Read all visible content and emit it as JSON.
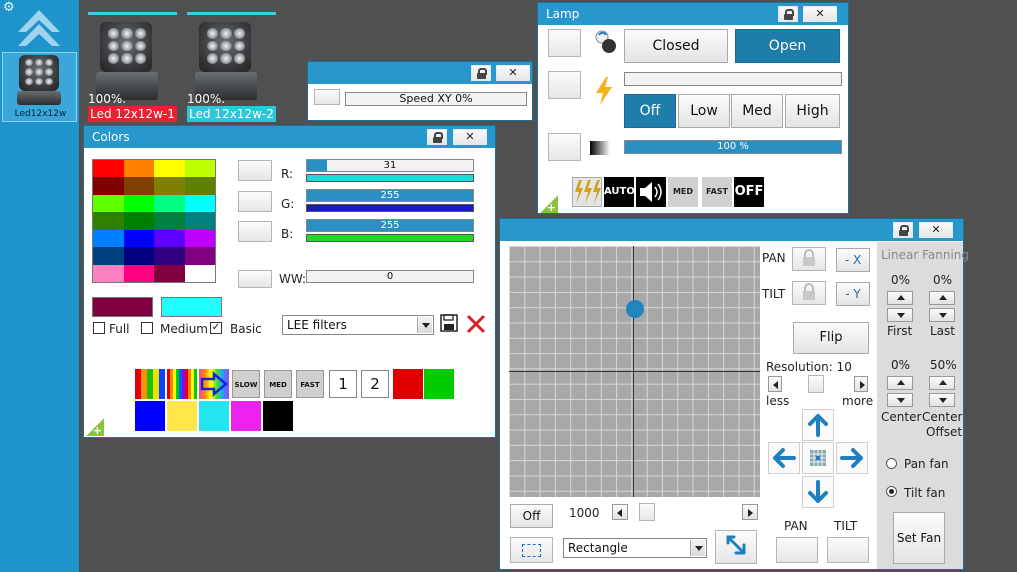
{
  "sidebar": {
    "selected_fixture_label": "Led12x12w"
  },
  "fixtures": [
    {
      "percent": "100%.",
      "label": "Led 12x12w-1",
      "label_bg": "#e52431",
      "label_color": "#ffffff"
    },
    {
      "percent": "100%.",
      "label": "Led 12x12w-2",
      "label_bg": "#2ec6d8",
      "label_color": "#ffffff"
    }
  ],
  "speed_window": {
    "bar_text": "Speed XY    0%"
  },
  "lamp": {
    "title": "Lamp",
    "closed_label": "Closed",
    "open_label": "Open",
    "speed_options": [
      "Off",
      "Low",
      "Med",
      "High"
    ],
    "selected_speed": "Off",
    "dimmer_text": "100 %",
    "dimmer_value": 100,
    "icons": {
      "auto": "AUTO",
      "med": "MED",
      "fast": "FAST",
      "off": "OFF"
    }
  },
  "colors": {
    "title": "Colors",
    "palette": [
      [
        "#ff0000",
        "#ff8000",
        "#ffff00",
        "#c0ff00"
      ],
      [
        "#800000",
        "#804000",
        "#808000",
        "#608000"
      ],
      [
        "#60ff00",
        "#00ff00",
        "#00ff80",
        "#00ffff"
      ],
      [
        "#308000",
        "#008000",
        "#008040",
        "#008080"
      ],
      [
        "#0080ff",
        "#0000ff",
        "#6000ff",
        "#c000ff"
      ],
      [
        "#004080",
        "#000080",
        "#300080",
        "#800080"
      ],
      [
        "#ff80c0",
        "#ff0080",
        "#800040",
        "#ffffff"
      ]
    ],
    "channels": [
      {
        "label": "R:",
        "value": "31",
        "fraction": 0.12,
        "track": "#22d8d8"
      },
      {
        "label": "G:",
        "value": "255",
        "fraction": 1.0,
        "track": "#1818c8"
      },
      {
        "label": "B:",
        "value": "255",
        "fraction": 1.0,
        "track": "#22d822"
      }
    ],
    "ww": {
      "label": "WW:",
      "value": "0",
      "fraction": 0
    },
    "current_color": "#800040",
    "target_color": "#1fffff",
    "checkboxes": [
      {
        "label": "Full",
        "checked": false
      },
      {
        "label": "Medium",
        "checked": false
      },
      {
        "label": "Basic",
        "checked": true
      }
    ],
    "filter_select": "LEE filters",
    "effect_tiles": {
      "slow": "SLOW",
      "med": "MED",
      "fast": "FAST"
    },
    "number_tiles": [
      "1",
      "2"
    ],
    "quick_colors": [
      "#e00000",
      "#00cc00",
      "#0000ff",
      "#ffe44a",
      "#22e5f0",
      "#ee22ee",
      "#000000"
    ]
  },
  "xy": {
    "pan_label": "PAN",
    "tilt_label": "TILT",
    "pan_invert": "- X",
    "tilt_invert": "- Y",
    "flip_label": "Flip",
    "resolution_text": "Resolution: 10",
    "less_label": "less",
    "more_label": "more",
    "off_label": "Off",
    "size_value": "1000",
    "shape_select": "Rectangle",
    "pan_bottom_label": "PAN",
    "tilt_bottom_label": "TILT",
    "dot_x": 0.5,
    "dot_y": 0.25,
    "fan": {
      "title": "Linear Fanning",
      "first_pct": "0%",
      "last_pct": "0%",
      "first_label": "First",
      "last_label": "Last",
      "center_pct": "0%",
      "offset_pct": "50%",
      "center_label": "Center",
      "center_offset_label_1": "Center",
      "center_offset_label_2": "Offset",
      "pan_fan_label": "Pan fan",
      "tilt_fan_label": "Tilt fan",
      "set_fan_label": "Set Fan",
      "selected": "tilt"
    }
  }
}
